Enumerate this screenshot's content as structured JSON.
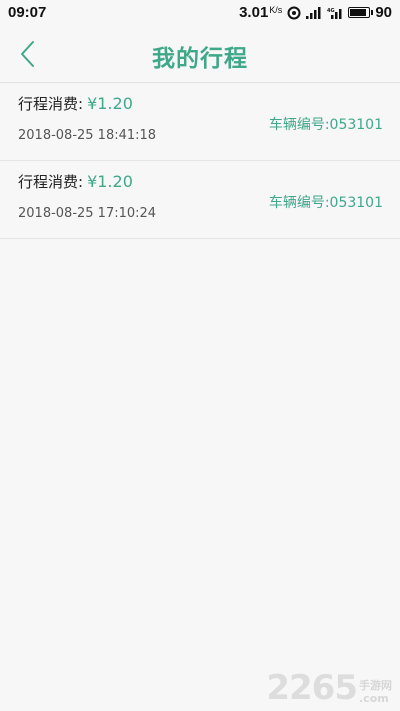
{
  "status_bar": {
    "time": "09:07",
    "speed": "3.01",
    "speed_unit": "K/s",
    "battery": "90",
    "icons": [
      "hotspot-icon",
      "signal-icon",
      "4g-signal-icon",
      "battery-icon"
    ]
  },
  "header": {
    "title": "我的行程",
    "back_icon": "chevron-left-icon"
  },
  "trips": [
    {
      "fare_label": "行程消费:",
      "fare": "¥1.20",
      "time": "2018-08-25 18:41:18",
      "vehicle": "车辆编号:053101"
    },
    {
      "fare_label": "行程消费:",
      "fare": "¥1.20",
      "time": "2018-08-25 17:10:24",
      "vehicle": "车辆编号:053101"
    }
  ],
  "watermark": {
    "main": "2265",
    "top": "手游网",
    "bottom": ".com"
  },
  "colors": {
    "accent": "#3fa889",
    "background": "#f7f7f7"
  }
}
